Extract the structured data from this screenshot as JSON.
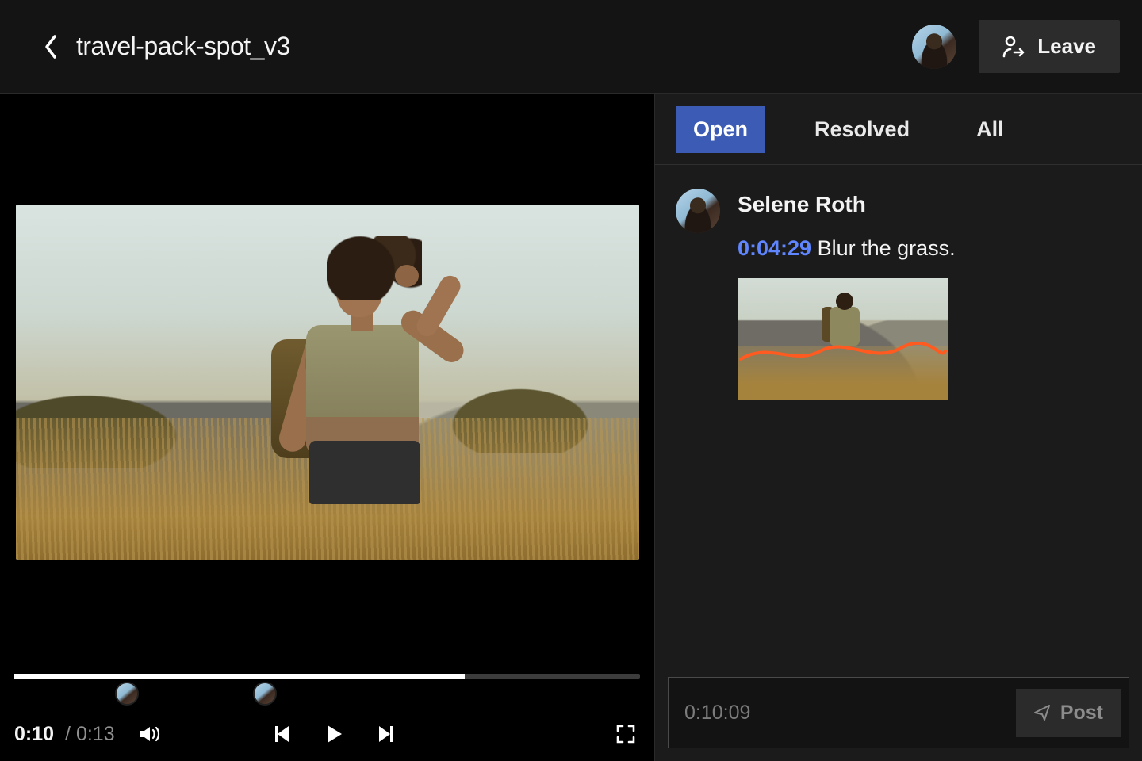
{
  "header": {
    "title": "travel-pack-spot_v3",
    "leave_label": "Leave"
  },
  "player": {
    "current_time": "0:10",
    "duration": "0:13",
    "progress_pct": 72,
    "markers_pct": [
      18,
      40
    ]
  },
  "sidebar": {
    "tabs": {
      "open": "Open",
      "resolved": "Resolved",
      "all": "All"
    },
    "active_tab": "open",
    "comments": [
      {
        "author": "Selene Roth",
        "timecode": "0:04:29",
        "text": "Blur the grass."
      }
    ],
    "composer_placeholder": "0:10:09",
    "post_label": "Post"
  },
  "colors": {
    "accent_blue": "#3b5bb5",
    "link_blue": "#5f86ff",
    "annotation": "#ff5a1f"
  }
}
